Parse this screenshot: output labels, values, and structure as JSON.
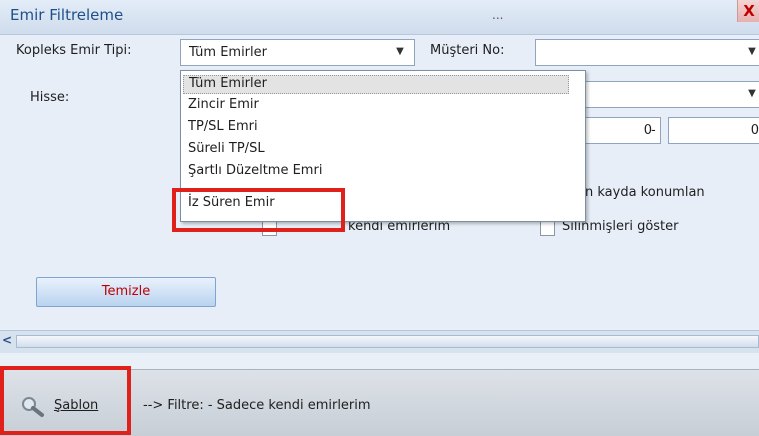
{
  "window": {
    "title": "Emir Filtreleme",
    "title_extra": "...",
    "close_label": "X"
  },
  "form": {
    "order_type_label": "Kopleks Emir Tipi:",
    "order_type_value": "Tüm Emirler",
    "customer_label": "Müşteri No:",
    "customer_value": "",
    "stock_label": "Hisse:",
    "stock_value": "",
    "range_from": "0",
    "range_sep": "-",
    "range_to": "0",
    "option_last_record": "n kayda konumlan",
    "option_own_orders": "kendi emirlerim",
    "option_show_deleted": "Silinmişleri göster"
  },
  "dropdown": {
    "items": [
      {
        "label": "Tüm Emirler"
      },
      {
        "label": "Zincir Emir"
      },
      {
        "label": "TP/SL Emri"
      },
      {
        "label": "Süreli TP/SL"
      },
      {
        "label": "Şartlı Düzeltme Emri"
      },
      {
        "label": "İz Süren Emir"
      }
    ],
    "selected_index": 0
  },
  "buttons": {
    "clear_label": "Temizle"
  },
  "statusbar": {
    "template_label": "Şablon",
    "filter_text": "--> Filtre: - Sadece kendi emirlerim"
  },
  "colors": {
    "highlight": "#e0201a",
    "clear_text": "#c00000",
    "title_text": "#1f4f8a"
  },
  "icons": {
    "search": "search-icon",
    "dropdown_arrow": "dropdown-arrow-icon",
    "close": "close-icon"
  }
}
